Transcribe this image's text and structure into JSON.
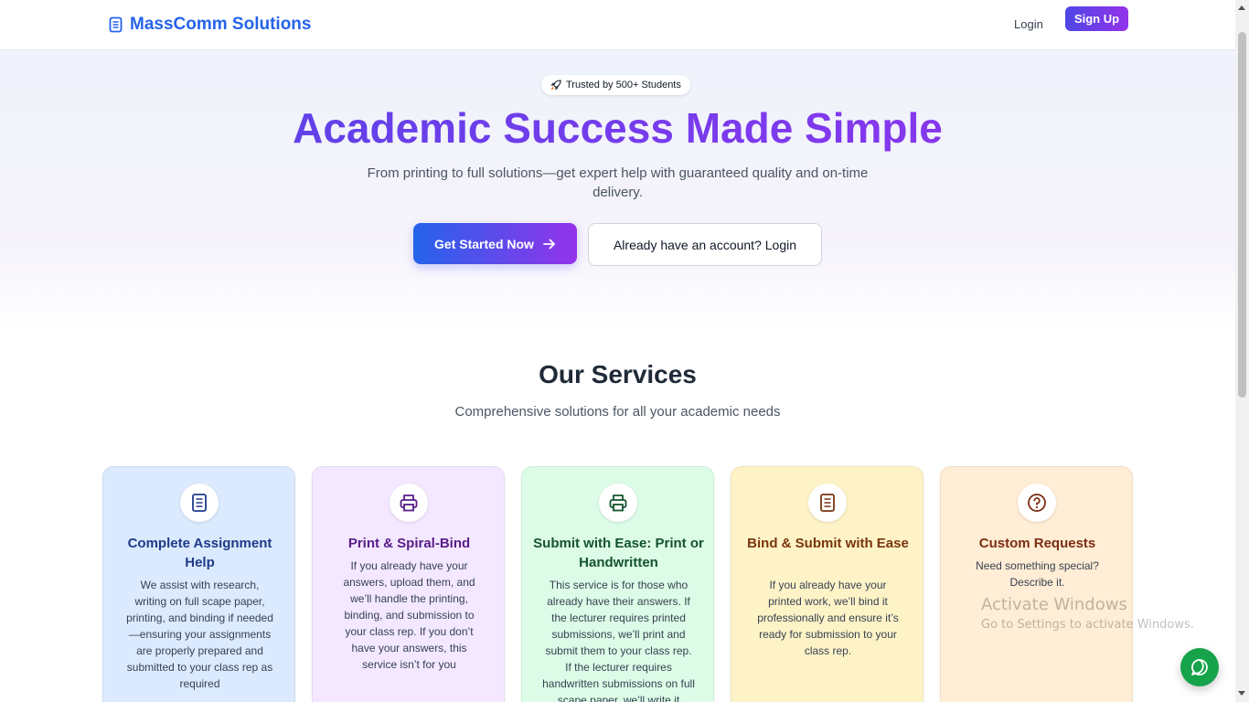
{
  "header": {
    "brand": "MassComm Solutions",
    "login_label": "Login",
    "signup_label": "Sign Up",
    "brand_color": "#2563eb"
  },
  "hero": {
    "badge_icon": "rocket-icon",
    "badge_text": "Trusted by 500+ Students",
    "title": "Academic Success Made Simple",
    "subtitle": "From printing to full solutions—get expert help with guaranteed quality and on-time delivery.",
    "primary_cta": "Get Started Now",
    "secondary_cta": "Already have an account? Login"
  },
  "services": {
    "title": "Our Services",
    "subtitle": "Comprehensive solutions for all your academic needs",
    "cards": [
      {
        "icon": "document-icon",
        "title": "Complete Assignment Help",
        "description": "We assist with research, writing on full scape paper, printing, and binding if needed—ensuring your assignments are properly prepared and submitted to your class rep as required",
        "bg": "#dbeafe",
        "title_color": "#1e3a8a"
      },
      {
        "icon": "printer-icon",
        "title": "Print & Spiral-Bind",
        "description": "If you already have your answers, upload them, and we’ll handle the printing, binding, and submission to your class rep. If you don’t have your answers, this service isn’t for you",
        "bg": "#f3e8ff",
        "title_color": "#581c87"
      },
      {
        "icon": "printer-icon",
        "title": "Submit with Ease: Print or Handwritten",
        "description": "This service is for those who already have their answers. If the lecturer requires printed submissions, we’ll print and submit them to your class rep. If the lecturer requires handwritten submissions on full scape paper, we’ll write it",
        "bg": "#dcfce7",
        "title_color": "#14532d"
      },
      {
        "icon": "book-icon",
        "title": "Bind & Submit with Ease",
        "description": "If you already have your printed work, we’ll bind it professionally and ensure it’s ready for submission to your class rep.",
        "bg": "#fef3c7",
        "title_color": "#78350f"
      },
      {
        "icon": "question-icon",
        "title": "Custom Requests",
        "description": "Need something special? Describe it.",
        "bg": "#ffedd5",
        "title_color": "#7c2d12"
      }
    ]
  },
  "watermark": {
    "line1": "Activate Windows",
    "line2": "Go to Settings to activate Windows."
  },
  "chat": {
    "icon": "chat-icon",
    "color": "#16a34a"
  }
}
